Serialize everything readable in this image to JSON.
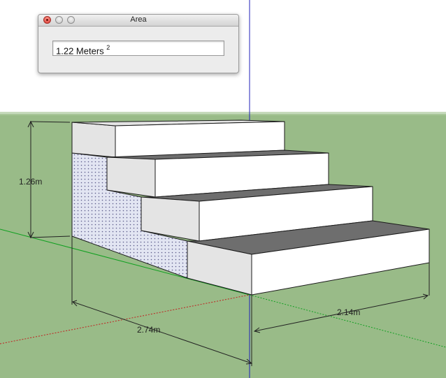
{
  "window": {
    "title": "Area"
  },
  "area_field": {
    "value": "1.22 Meters",
    "unit_exponent": "2"
  },
  "dimensions": {
    "height_label": "1.26m",
    "length_label": "2.74m",
    "depth_label": "2.14m"
  },
  "colors": {
    "sky": "#ffffff",
    "ground": "#99bb88",
    "axis_blue": "#1a1ab0",
    "axis_red": "#c02020",
    "axis_green": "#10a020",
    "tread": "#6e6e6e",
    "riser_face": "#ffffff",
    "side_face": "#e4e4e4",
    "selected_fill": "#dfe3f1",
    "close_button": "#e0403a"
  }
}
